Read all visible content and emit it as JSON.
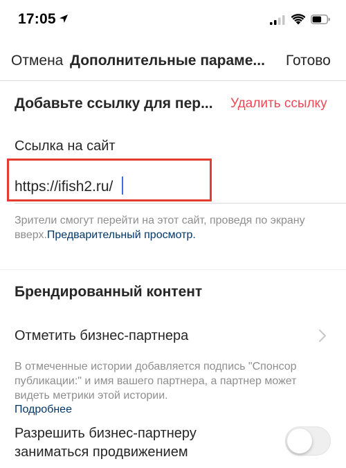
{
  "status_bar": {
    "time": "17:05",
    "icons": [
      "location-arrow-icon",
      "cellular-signal-icon",
      "wifi-icon",
      "battery-icon"
    ]
  },
  "nav": {
    "cancel_label": "Отмена",
    "title": "Дополнительные параме...",
    "done_label": "Готово"
  },
  "link_section": {
    "heading": "Добавьте ссылку для пер...",
    "delete_label": "Удалить ссылку",
    "field_label": "Ссылка на сайт",
    "url_value": "https://ifish2.ru/",
    "hint_text": "Зрители смогут перейти на этот сайт, проведя по экрану вверх.",
    "preview_link": "Предварительный просмотр."
  },
  "branded_section": {
    "heading": "Брендированный контент",
    "tag_partner_label": "Отметить бизнес-партнера",
    "description": "В отмеченные истории добавляется подпись \"Спонсор публикации:\" и имя вашего партнера, а партнер может видеть метрики этой истории.",
    "learn_more": "Подробнее",
    "allow_promotion_label": "Разрешить бизнес-партнеру заниматься продвижением",
    "allow_promotion_enabled": false
  },
  "colors": {
    "accent_red": "#ed4956",
    "highlight_border": "#e53a2f",
    "link_blue": "#00376b",
    "muted_text": "#8e8e8e"
  }
}
